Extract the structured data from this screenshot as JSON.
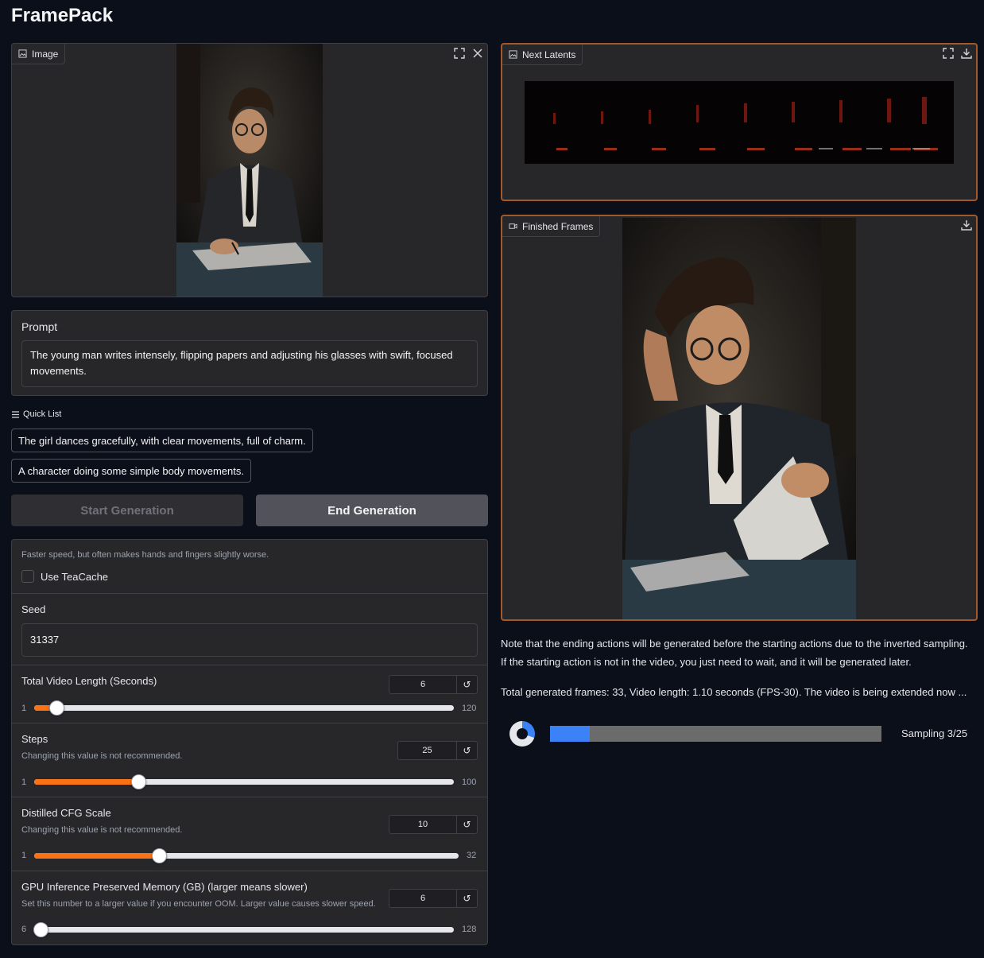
{
  "app": {
    "title": "FramePack"
  },
  "image_panel": {
    "label": "Image"
  },
  "prompt": {
    "label": "Prompt",
    "value": "The young man writes intensely, flipping papers and adjusting his glasses with swift, focused movements."
  },
  "quick_list": {
    "label": "Quick List",
    "items": [
      "The girl dances gracefully, with clear movements, full of charm.",
      "A character doing some simple body movements."
    ]
  },
  "buttons": {
    "start": "Start Generation",
    "end": "End Generation"
  },
  "teacache": {
    "info": "Faster speed, but often makes hands and fingers slightly worse.",
    "label": "Use TeaCache",
    "checked": false
  },
  "seed": {
    "label": "Seed",
    "value": "31337"
  },
  "sliders": {
    "video_length": {
      "label": "Total Video Length (Seconds)",
      "value": "6",
      "min": "1",
      "max": "120"
    },
    "steps": {
      "label": "Steps",
      "info": "Changing this value is not recommended.",
      "value": "25",
      "min": "1",
      "max": "100"
    },
    "cfg": {
      "label": "Distilled CFG Scale",
      "info": "Changing this value is not recommended.",
      "value": "10",
      "min": "1",
      "max": "32"
    },
    "gpu_mem": {
      "label": "GPU Inference Preserved Memory (GB) (larger means slower)",
      "info": "Set this number to a larger value if you encounter OOM. Larger value causes slower speed.",
      "value": "6",
      "min": "6",
      "max": "128"
    }
  },
  "latents_panel": {
    "label": "Next Latents"
  },
  "frames_panel": {
    "label": "Finished Frames"
  },
  "notes": {
    "line1": "Note that the ending actions will be generated before the starting actions due to the inverted sampling.",
    "line2": "If the starting action is not in the video, you just need to wait, and it will be generated later.",
    "status": "Total generated frames: 33, Video length: 1.10 seconds (FPS-30). The video is being extended now ..."
  },
  "progress": {
    "label": "Sampling 3/25",
    "fraction": 0.12
  },
  "colors": {
    "accent": "#f97316",
    "progress": "#3b82f6",
    "border_active": "#a0592a"
  },
  "icons": [
    "image-icon",
    "fullscreen-icon",
    "close-icon",
    "download-icon",
    "video-icon",
    "list-icon",
    "reset-icon"
  ]
}
